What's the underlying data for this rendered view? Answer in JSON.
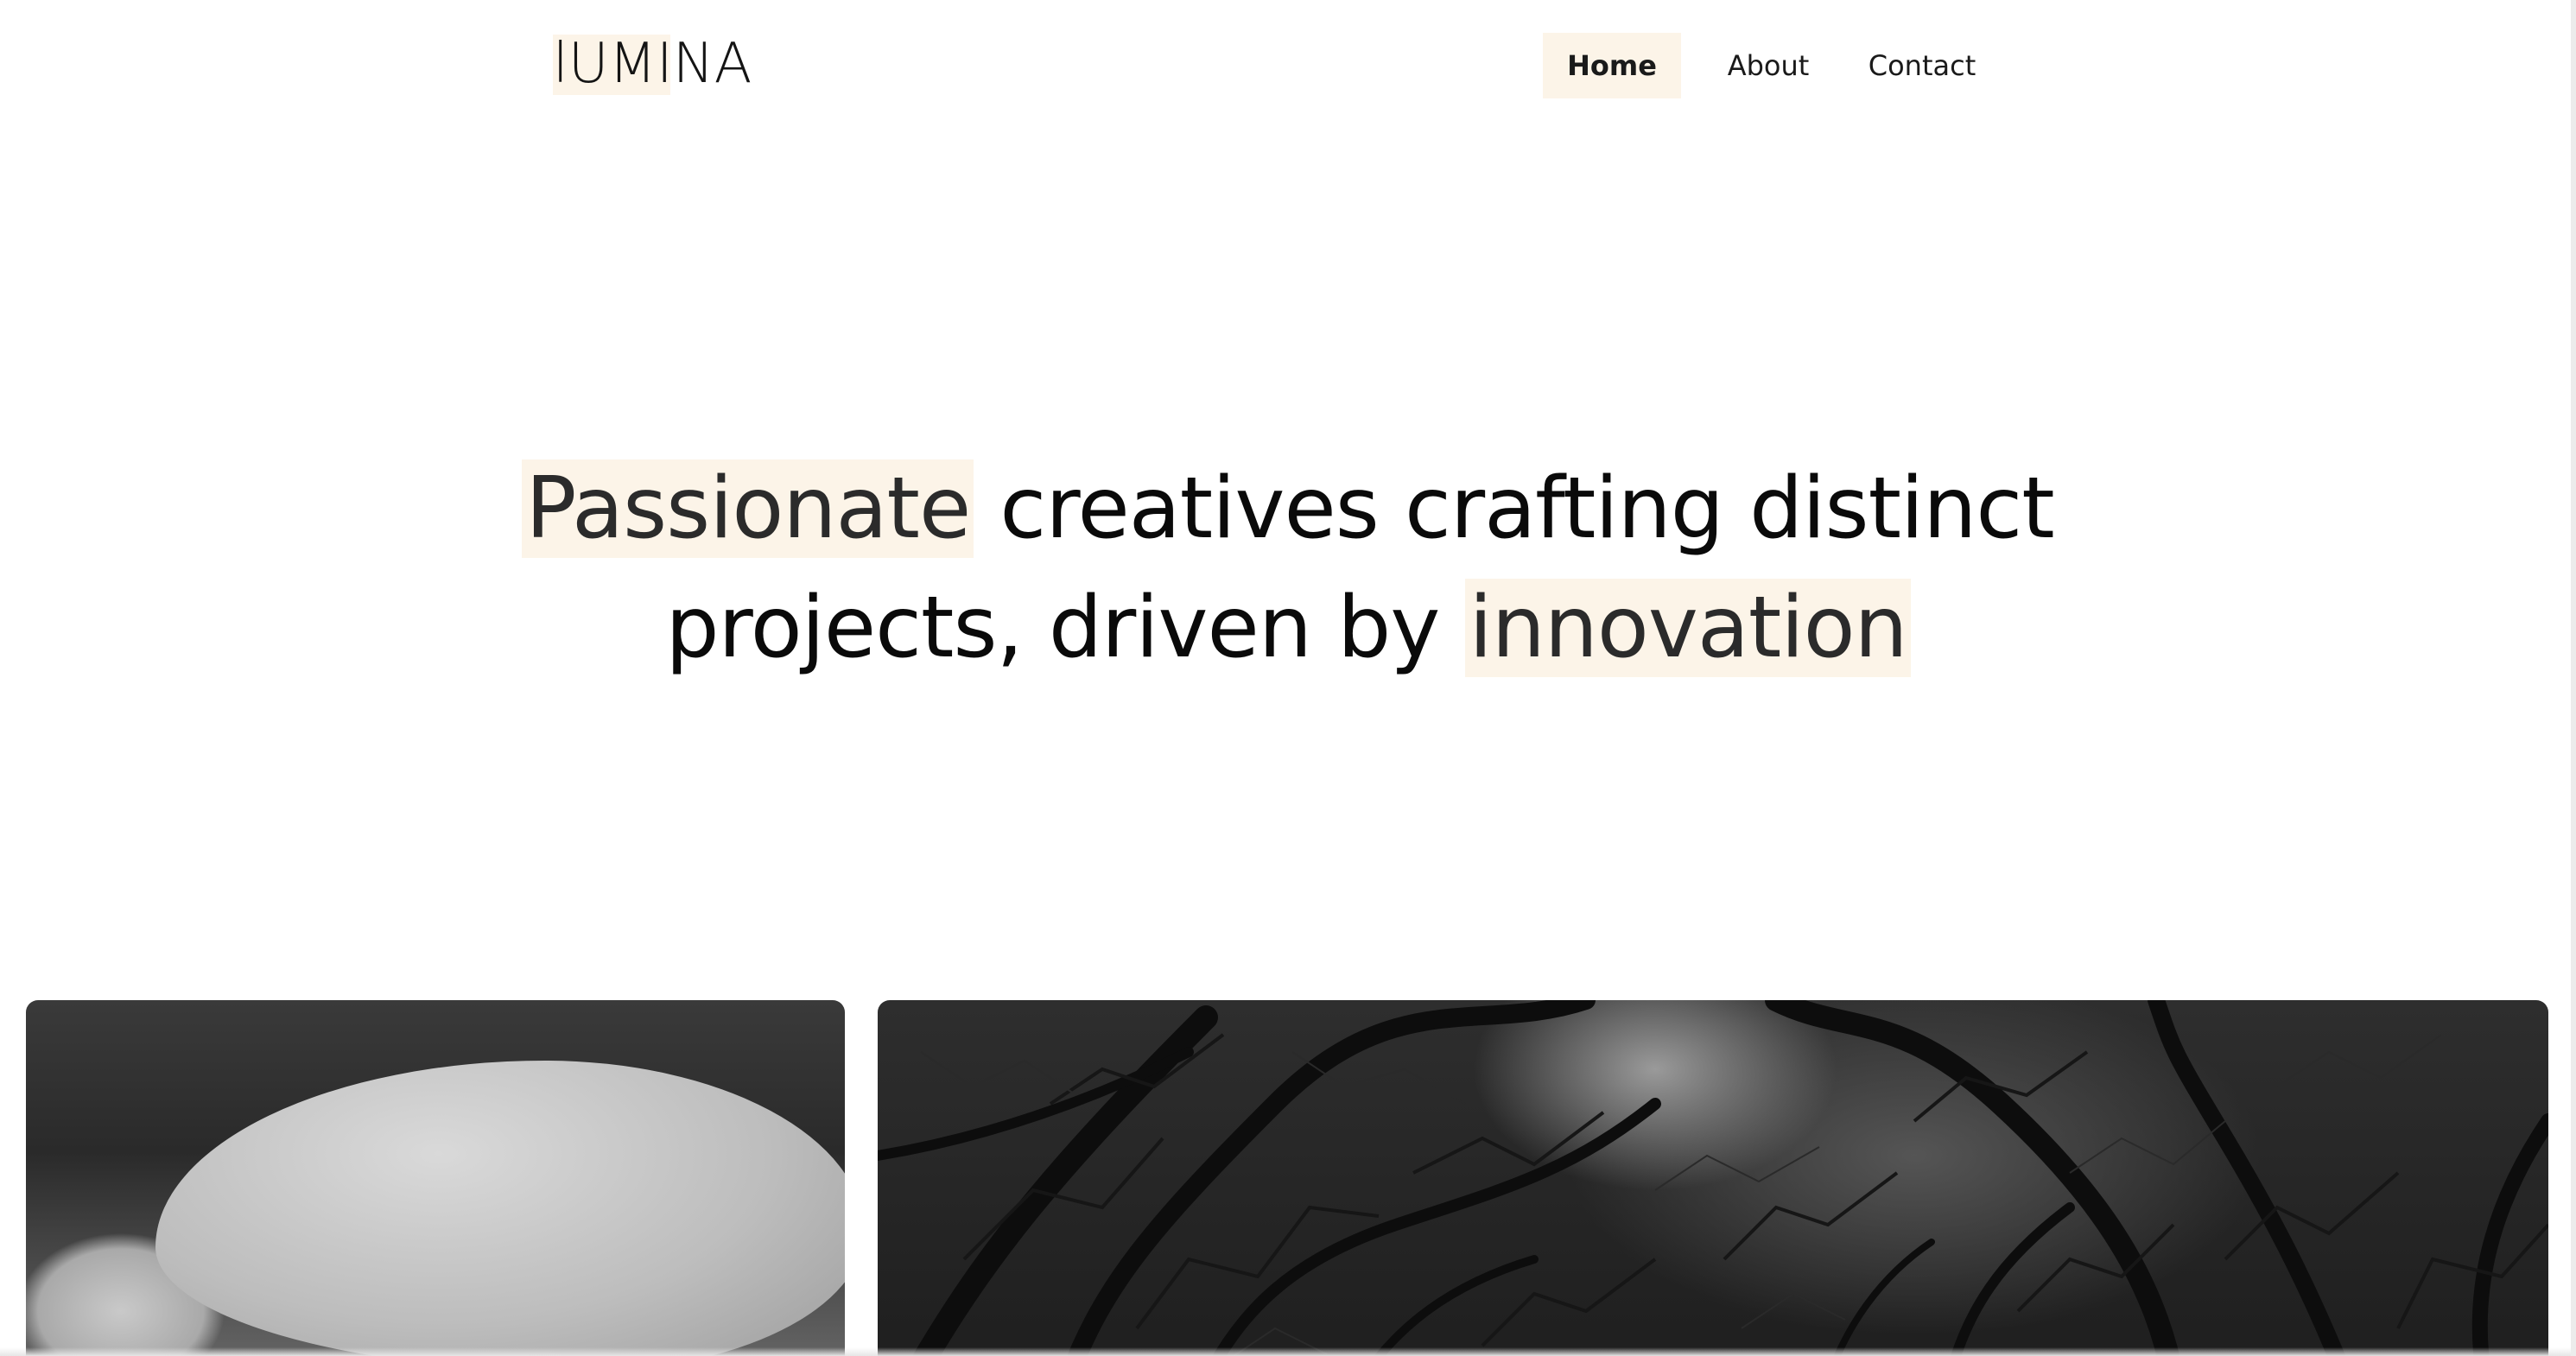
{
  "header": {
    "logo": "lUMINA",
    "nav": [
      {
        "label": "Home",
        "active": true
      },
      {
        "label": "About",
        "active": false
      },
      {
        "label": "Contact",
        "active": false
      }
    ]
  },
  "hero": {
    "line1_highlight": "Passionate",
    "line1_rest": " creatives crafting distinct",
    "line2_start": "projects, driven by ",
    "line2_highlight": "innovation"
  },
  "gallery": {
    "images": [
      {
        "subject": "black and white close-up of a petal"
      },
      {
        "subject": "black and white tangled tree branches"
      }
    ]
  },
  "colors": {
    "highlight": "#fcf4e8",
    "text": "#0a0a0a",
    "background": "#ffffff"
  }
}
